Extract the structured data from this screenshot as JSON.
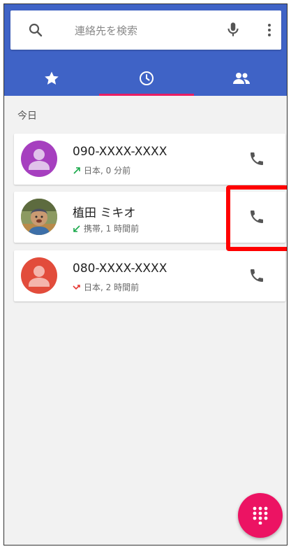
{
  "search": {
    "placeholder": "連絡先を検索",
    "search_icon": "search-icon",
    "mic_icon": "mic-icon",
    "more_icon": "more-vert-icon"
  },
  "tabs": [
    {
      "name": "favorites",
      "icon": "star-icon",
      "selected": false
    },
    {
      "name": "recents",
      "icon": "clock-icon",
      "selected": true
    },
    {
      "name": "contacts",
      "icon": "people-icon",
      "selected": false
    }
  ],
  "section_header": "今日",
  "calls": [
    {
      "name": "090-XXXX-XXXX",
      "type": "outgoing",
      "detail": "日本, 0 分前",
      "avatar": "default-avatar-purple"
    },
    {
      "name": "植田 ミキオ",
      "type": "incoming",
      "detail": "携帯, 1 時間前",
      "avatar": "photo-avatar"
    },
    {
      "name": "080-XXXX-XXXX",
      "type": "missed",
      "detail": "日本, 2 時間前",
      "avatar": "default-avatar-red"
    }
  ],
  "colors": {
    "appbar": "#3f63c6",
    "tab_indicator": "#e91e63",
    "fab": "#ec1363",
    "avatar_purple": "#a63fbf",
    "avatar_red": "#e24c3b",
    "outgoing_arrow": "#1aa94b",
    "incoming_arrow": "#1aa94b",
    "missed_arrow": "#e53935",
    "highlight": "#ff0000"
  },
  "fab": {
    "icon": "dialpad-icon"
  }
}
